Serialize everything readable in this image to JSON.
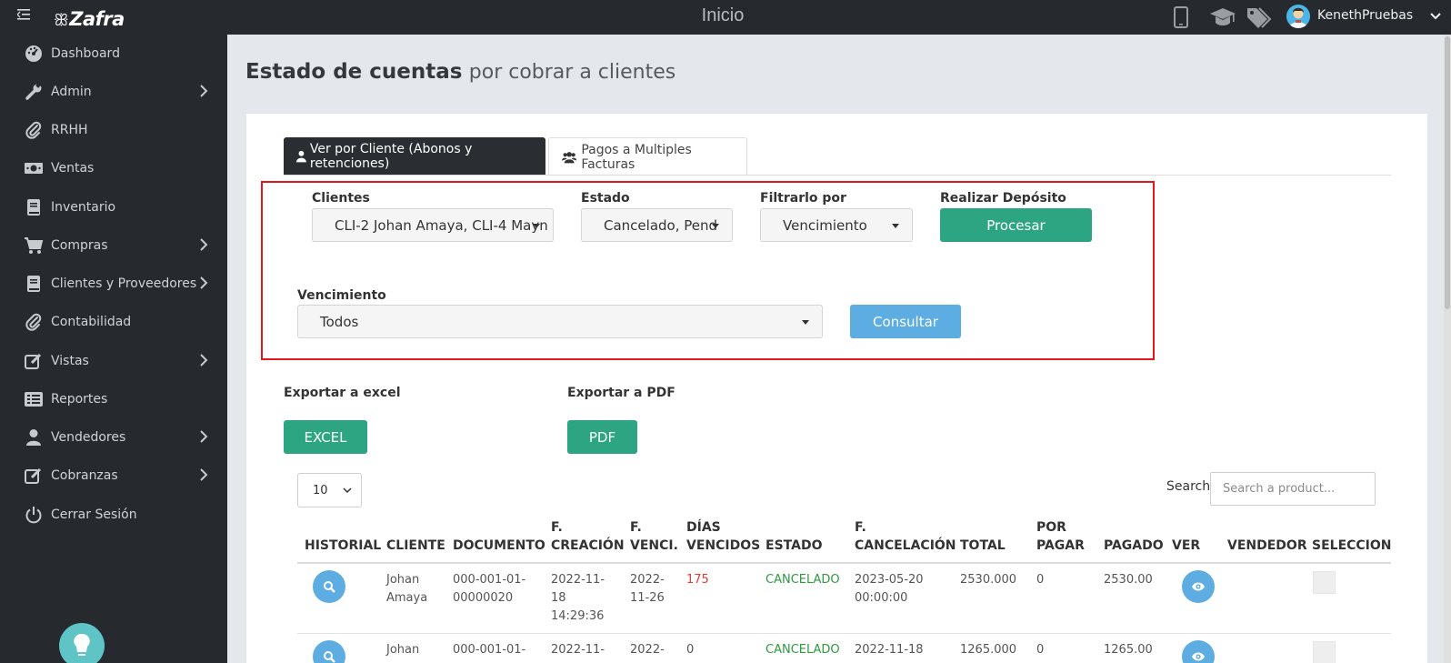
{
  "app": {
    "logo": "Zafra",
    "title": "Inicio",
    "username": "KenethPruebas"
  },
  "sidebar": {
    "items": [
      {
        "label": "Dashboard",
        "icon": "dashboard-icon",
        "has_submenu": false
      },
      {
        "label": "Admin",
        "icon": "wrench-icon",
        "has_submenu": true
      },
      {
        "label": "RRHH",
        "icon": "paperclip-icon",
        "has_submenu": false
      },
      {
        "label": "Ventas",
        "icon": "money-icon",
        "has_submenu": false
      },
      {
        "label": "Inventario",
        "icon": "book-icon",
        "has_submenu": false
      },
      {
        "label": "Compras",
        "icon": "cart-icon",
        "has_submenu": true
      },
      {
        "label": "Clientes y Proveedores",
        "icon": "book-icon",
        "has_submenu": true
      },
      {
        "label": "Contabilidad",
        "icon": "paperclip-icon",
        "has_submenu": false
      },
      {
        "label": "Vistas",
        "icon": "edit-icon",
        "has_submenu": true
      },
      {
        "label": "Reportes",
        "icon": "list-icon",
        "has_submenu": false
      },
      {
        "label": "Vendedores",
        "icon": "user-icon",
        "has_submenu": true
      },
      {
        "label": "Cobranzas",
        "icon": "edit-icon",
        "has_submenu": true
      },
      {
        "label": "Cerrar Sesión",
        "icon": "power-icon",
        "has_submenu": false
      }
    ]
  },
  "page": {
    "title_bold": "Estado de cuentas",
    "title_rest": "por cobrar a clientes"
  },
  "tabs": [
    {
      "label": "Ver por Cliente (Abonos y retenciones)",
      "active": true
    },
    {
      "label": "Pagos a Multiples Facturas",
      "active": false
    }
  ],
  "filters": {
    "clientes": {
      "label": "Clientes",
      "value": "CLI-2 Johan Amaya, CLI-4 Mayn"
    },
    "estado": {
      "label": "Estado",
      "value": "Cancelado, Pend"
    },
    "filtrar": {
      "label": "Filtrarlo por",
      "value": "Vencimiento"
    },
    "deposito": {
      "label": "Realizar Depósito",
      "button": "Procesar"
    },
    "vencimiento": {
      "label": "Vencimiento",
      "value": "Todos"
    },
    "consultar": "Consultar"
  },
  "export": {
    "excel_label": "Exportar a excel",
    "excel_button": "EXCEL",
    "pdf_label": "Exportar a PDF",
    "pdf_button": "PDF"
  },
  "table_controls": {
    "page_size": "10",
    "search_label": "Search:",
    "search_placeholder": "Search a product..."
  },
  "table": {
    "headers": {
      "historial": "HISTORIAL",
      "cliente": "CLIENTE",
      "documento": "DOCUMENTO",
      "f_creacion_1": "F.",
      "f_creacion_2": "CREACIÓN",
      "f_venci_1": "F.",
      "f_venci_2": "VENCI.",
      "dias_1": "DÍAS",
      "dias_2": "VENCIDOS",
      "estado": "ESTADO",
      "f_cancel_1": "F.",
      "f_cancel_2": "CANCELACIÓN",
      "total": "TOTAL",
      "por_pagar_1": "POR",
      "por_pagar_2": "PAGAR",
      "pagado": "PAGADO",
      "ver": "VER",
      "vendedor": "VENDEDOR",
      "seleccionar": "SELECCIONA"
    },
    "rows": [
      {
        "cliente_1": "Johan",
        "cliente_2": "Amaya",
        "documento_1": "000-001-01-",
        "documento_2": "00000020",
        "creacion_1": "2022-11-",
        "creacion_2": "18",
        "creacion_3": "14:29:36",
        "venci_1": "2022-",
        "venci_2": "11-26",
        "dias": "175",
        "estado": "CANCELADO",
        "cancel_1": "2023-05-20",
        "cancel_2": "00:00:00",
        "total": "2530.000",
        "por_pagar": "0",
        "pagado": "2530.00"
      },
      {
        "cliente_1": "Johan",
        "documento_1": "000-001-01-",
        "creacion_1": "2022-11-",
        "venci_1": "2022-",
        "dias": "0",
        "estado": "CANCELADO",
        "cancel_1": "2022-11-18",
        "total": "1265.000",
        "por_pagar": "0",
        "pagado": "1265.00"
      }
    ]
  },
  "colors": {
    "sidebar_bg": "#262a2e",
    "accent_green": "#2ea582",
    "accent_blue": "#5dade2",
    "highlight_red": "#e2161b"
  }
}
